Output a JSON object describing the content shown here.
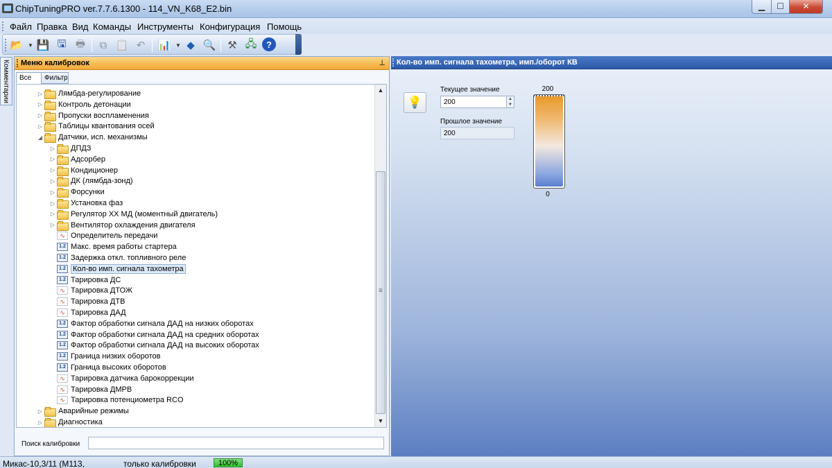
{
  "window": {
    "title": "ChipTuningPRO ver.7.7.6.1300 - 114_VN_K68_E2.bin",
    "controls": {
      "minimize": "▁",
      "maximize": "☐",
      "close": "✕"
    }
  },
  "menu": [
    {
      "label": "Файл"
    },
    {
      "label": "Правка"
    },
    {
      "label": "Вид"
    },
    {
      "label": "Команды"
    },
    {
      "label": "Инструменты"
    },
    {
      "label": "Конфигурация"
    },
    {
      "label": "Помощь"
    }
  ],
  "toolbar": {
    "icons": [
      "open-folder-icon",
      "save-icon",
      "save-as-icon",
      "print-icon",
      "copy-icon",
      "paste-icon",
      "undo-icon",
      "chart-tools-icon",
      "diamond-nav-icon",
      "magnifier-icon",
      "connector-icon",
      "network-icon",
      "help-icon"
    ]
  },
  "side_tab": {
    "label": "Комментарии"
  },
  "left_panel": {
    "title": "Меню калибровок",
    "pin": "⊥",
    "tabs": [
      {
        "label": "Все"
      },
      {
        "label": "Фильтр"
      }
    ],
    "tree": [
      {
        "label": "Лямбда-регулирование",
        "level": 0,
        "type": "folder",
        "expander": "▷"
      },
      {
        "label": "Контроль детонации",
        "level": 0,
        "type": "folder",
        "expander": "▷"
      },
      {
        "label": "Пропуски воспламенения",
        "level": 0,
        "type": "folder",
        "expander": "▷"
      },
      {
        "label": "Таблицы квантования осей",
        "level": 0,
        "type": "folder",
        "expander": "▷"
      },
      {
        "label": "Датчики, исп. механизмы",
        "level": 0,
        "type": "folder",
        "expander": "◢"
      },
      {
        "label": "ДПДЗ",
        "level": 1,
        "type": "folder",
        "expander": "▷"
      },
      {
        "label": "Адсорбер",
        "level": 1,
        "type": "folder",
        "expander": "▷"
      },
      {
        "label": "Кондиционер",
        "level": 1,
        "type": "folder",
        "expander": "▷"
      },
      {
        "label": "ДК (лямбда-зонд)",
        "level": 1,
        "type": "folder",
        "expander": "▷"
      },
      {
        "label": "Форсунки",
        "level": 1,
        "type": "folder",
        "expander": "▷"
      },
      {
        "label": "Установка фаз",
        "level": 1,
        "type": "folder",
        "expander": "▷"
      },
      {
        "label": "Регулятор ХХ МД (моментный двигатель)",
        "level": 1,
        "type": "folder",
        "expander": "▷"
      },
      {
        "label": "Вентилятор охлаждения двигателя",
        "level": 1,
        "type": "folder",
        "expander": "▷"
      },
      {
        "label": "Определитель передачи",
        "level": 1,
        "type": "curve"
      },
      {
        "label": "Макс. время работы стартера",
        "level": 1,
        "type": "num"
      },
      {
        "label": "Задержка откл. топливного реле",
        "level": 1,
        "type": "num"
      },
      {
        "label": "Кол-во имп. сигнала тахометра",
        "level": 1,
        "type": "num",
        "selected": true
      },
      {
        "label": "Тарировка ДС",
        "level": 1,
        "type": "num"
      },
      {
        "label": "Тарировка ДТОЖ",
        "level": 1,
        "type": "curve"
      },
      {
        "label": "Тарировка ДТВ",
        "level": 1,
        "type": "curve"
      },
      {
        "label": "Тарировка ДАД",
        "level": 1,
        "type": "curve"
      },
      {
        "label": "Фактор обработки сигнала ДАД на низких оборотах",
        "level": 1,
        "type": "num"
      },
      {
        "label": "Фактор обработки сигнала ДАД на средних оборотах",
        "level": 1,
        "type": "num"
      },
      {
        "label": "Фактор обработки сигнала ДАД на высоких оборотах",
        "level": 1,
        "type": "num"
      },
      {
        "label": "Граница низких оборотов",
        "level": 1,
        "type": "num"
      },
      {
        "label": "Граница высоких оборотов",
        "level": 1,
        "type": "num"
      },
      {
        "label": "Тарировка датчика барокоррекции",
        "level": 1,
        "type": "curve"
      },
      {
        "label": "Тарировка ДМРВ",
        "level": 1,
        "type": "curve"
      },
      {
        "label": "Тарировка потенциометра RCO",
        "level": 1,
        "type": "curve"
      },
      {
        "label": "Аварийные режимы",
        "level": 0,
        "type": "folder",
        "expander": "▷"
      },
      {
        "label": "Диагностика",
        "level": 0,
        "type": "folder",
        "expander": "▷"
      }
    ],
    "search": {
      "label": "Поиск калибровки",
      "value": ""
    }
  },
  "right_panel": {
    "title": "Кол-во имп. сигнала тахометра, имп./оборот КВ",
    "current_label": "Текущее значение",
    "current_value": "200",
    "previous_label": "Прошлое значение",
    "previous_value": "200",
    "gauge": {
      "max": "200",
      "min": "0",
      "level": 1.0
    }
  },
  "status": {
    "left": "Микас-10,3/11 (М113,",
    "middle": "только калибровки",
    "progress": "100%"
  },
  "colors": {
    "panel_header_orange": "#f6b94f",
    "panel_header_blue": "#2c5aa8",
    "progress_green": "#2fbf2f"
  }
}
